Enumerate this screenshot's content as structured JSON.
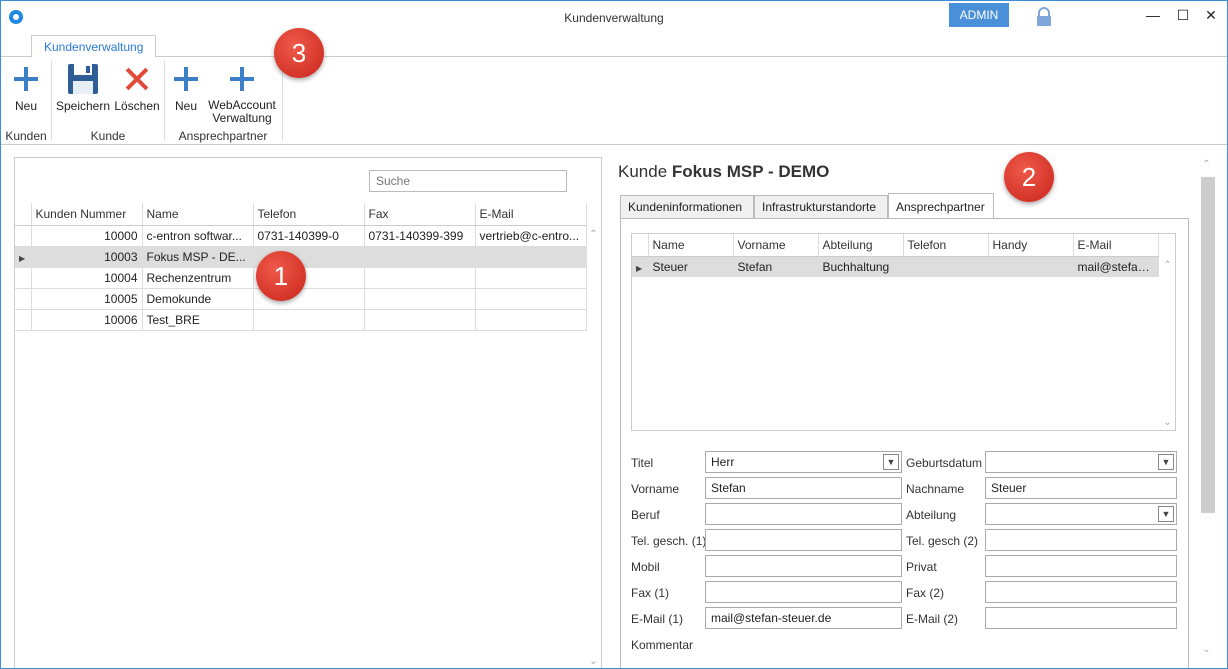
{
  "window": {
    "title": "Kundenverwaltung",
    "admin_label": "ADMIN",
    "minimize": "—",
    "maximize": "☐",
    "close": "✕"
  },
  "ribbon": {
    "tab": "Kundenverwaltung",
    "buttons": {
      "kunden_neu": "Neu",
      "speichern": "Speichern",
      "loeschen": "Löschen",
      "ap_neu": "Neu",
      "webaccount_1": "WebAccount",
      "webaccount_2": "Verwaltung"
    },
    "groups": {
      "kunden": "Kunden",
      "kunde": "Kunde",
      "ansprechpartner": "Ansprechpartner"
    }
  },
  "badges": {
    "b1": "1",
    "b2": "2",
    "b3": "3"
  },
  "customers": {
    "search_placeholder": "Suche",
    "columns": [
      "Kunden Nummer",
      "Name",
      "Telefon",
      "Fax",
      "E-Mail"
    ],
    "rows": [
      {
        "nr": "10000",
        "name": "c-entron softwar...",
        "tel": "0731-140399-0",
        "fax": "0731-140399-399",
        "mail": "vertrieb@c-entro..."
      },
      {
        "nr": "10003",
        "name": "Fokus MSP - DE...",
        "tel": "",
        "fax": "",
        "mail": ""
      },
      {
        "nr": "10004",
        "name": "Rechenzentrum",
        "tel": "",
        "fax": "",
        "mail": ""
      },
      {
        "nr": "10005",
        "name": "Demokunde",
        "tel": "",
        "fax": "",
        "mail": ""
      },
      {
        "nr": "10006",
        "name": "Test_BRE",
        "tel": "",
        "fax": "",
        "mail": ""
      }
    ]
  },
  "detail": {
    "title_prefix": "Kunde",
    "title_name": "Fokus MSP - DEMO",
    "tabs": [
      "Kundeninformationen",
      "Infrastrukturstandorte",
      "Ansprechpartner"
    ],
    "contacts": {
      "columns": [
        "Name",
        "Vorname",
        "Abteilung",
        "Telefon",
        "Handy",
        "E-Mail"
      ],
      "rows": [
        {
          "name": "Steuer",
          "vorname": "Stefan",
          "abteilung": "Buchhaltung",
          "telefon": "",
          "handy": "",
          "mail": "mail@stefan..."
        }
      ]
    },
    "form": {
      "titel_label": "Titel",
      "titel_value": "Herr",
      "geburtsdatum_label": "Geburtsdatum",
      "geburtsdatum_value": "",
      "vorname_label": "Vorname",
      "vorname_value": "Stefan",
      "nachname_label": "Nachname",
      "nachname_value": "Steuer",
      "beruf_label": "Beruf",
      "beruf_value": "",
      "abteilung_label": "Abteilung",
      "abteilung_value": "",
      "tel1_label": "Tel. gesch. (1)",
      "tel1_value": "",
      "tel2_label": "Tel. gesch (2)",
      "tel2_value": "",
      "mobil_label": "Mobil",
      "mobil_value": "",
      "privat_label": "Privat",
      "privat_value": "",
      "fax1_label": "Fax (1)",
      "fax1_value": "",
      "fax2_label": "Fax (2)",
      "fax2_value": "",
      "mail1_label": "E-Mail (1)",
      "mail1_value": "mail@stefan-steuer.de",
      "mail2_label": "E-Mail (2)",
      "mail2_value": "",
      "kommentar_label": "Kommentar"
    }
  },
  "colors": {
    "accent": "#2a7ad5",
    "admin": "#4a90d9",
    "badge": "#d9342b"
  }
}
